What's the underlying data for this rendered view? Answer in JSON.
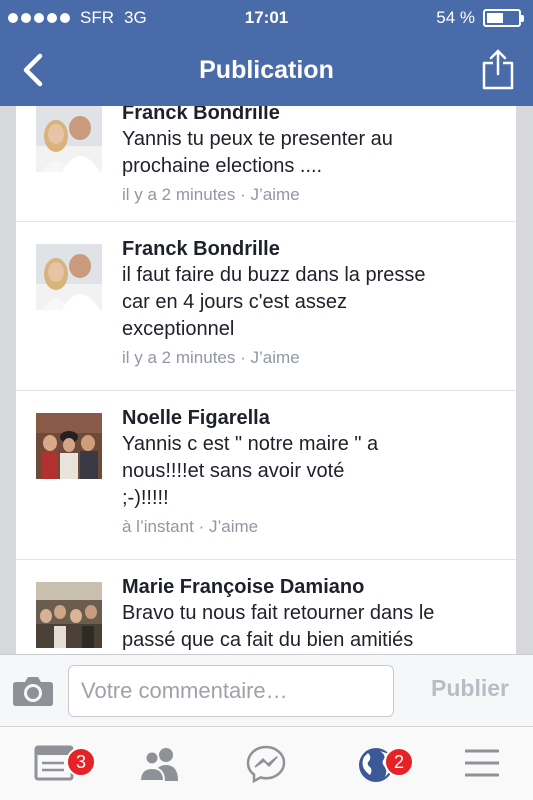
{
  "status_bar": {
    "carrier": "SFR",
    "network": "3G",
    "time": "17:01",
    "battery": "54 %",
    "battery_level": 0.54
  },
  "nav": {
    "title": "Publication"
  },
  "comments": [
    {
      "name": "Franck Bondrille",
      "lines": [
        "Yannis tu peux te presenter au",
        "prochaine elections ...."
      ],
      "time": "il y a 2 minutes",
      "separator": "·",
      "like": "J’aime"
    },
    {
      "name": "Franck Bondrille",
      "lines": [
        "il faut faire du buzz dans la presse",
        "car en 4 jours c'est assez",
        "exceptionnel"
      ],
      "time": "il y a 2 minutes",
      "separator": "·",
      "like": "J’aime"
    },
    {
      "name": "Noelle Figarella",
      "lines": [
        "Yannis c est \" notre maire \" a",
        "nous!!!!et sans avoir voté",
        ";-)!!!!!"
      ],
      "time": "à l’instant",
      "separator": "·",
      "like": "J’aime"
    },
    {
      "name": "Marie Françoise Damiano",
      "lines": [
        "Bravo tu nous fait retourner dans le",
        "passé que ca fait du bien amitiés"
      ],
      "time": "",
      "separator": "",
      "like": ""
    }
  ],
  "composer": {
    "placeholder": "Votre commentaire…",
    "publish_label": "Publier"
  },
  "tabbar": {
    "tabs": [
      {
        "icon": "news-feed-icon",
        "badge": "3"
      },
      {
        "icon": "friends-icon",
        "badge": ""
      },
      {
        "icon": "messenger-icon",
        "badge": ""
      },
      {
        "icon": "globe-icon",
        "badge": "2"
      },
      {
        "icon": "menu-icon",
        "badge": ""
      }
    ]
  },
  "colors": {
    "header": "#4a6ba9",
    "badge": "#e62227",
    "meta_text": "#9197a3"
  }
}
